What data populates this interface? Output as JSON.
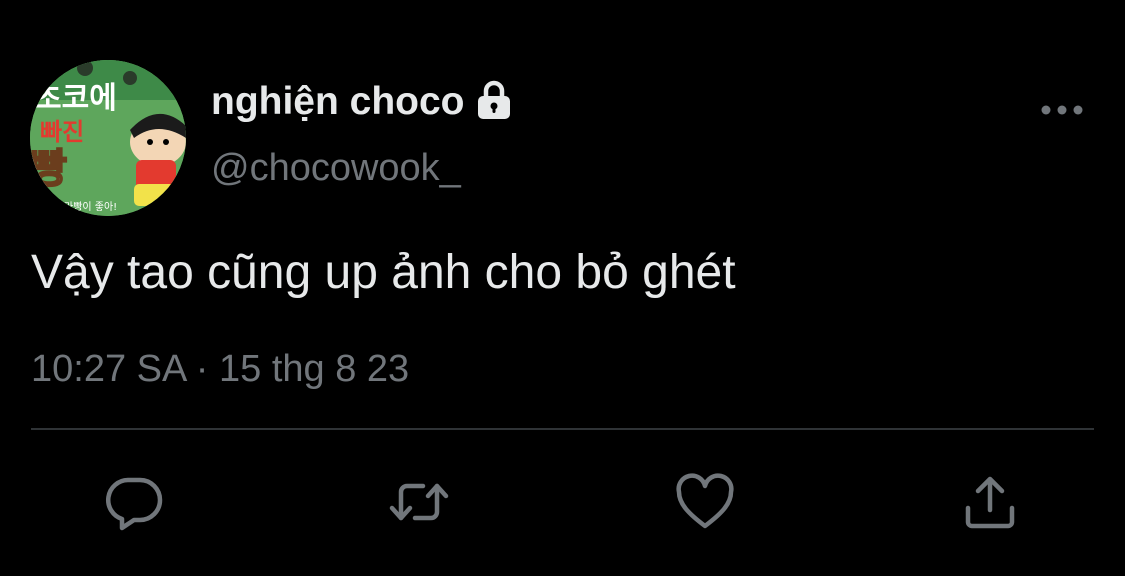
{
  "tweet": {
    "display_name": "nghiện choco",
    "handle": "@chocowook_",
    "text": "Vậy tao cũng up ảnh cho bỏ ghét",
    "timestamp": "10:27 SA · 15 thg 8 23",
    "protected": true
  },
  "avatar": {
    "text_line1": "초코에",
    "text_line2": "빠진",
    "text_line3": "빵",
    "text_small": "라빵이 좋아!"
  },
  "icons": {
    "lock": "lock-icon",
    "more": "more-horizontal-icon",
    "reply": "reply-icon",
    "retweet": "retweet-icon",
    "like": "heart-icon",
    "share": "share-icon"
  },
  "colors": {
    "background": "#000000",
    "primary_text": "#e7e9ea",
    "secondary_text": "#71767b",
    "divider": "#2f3336"
  }
}
